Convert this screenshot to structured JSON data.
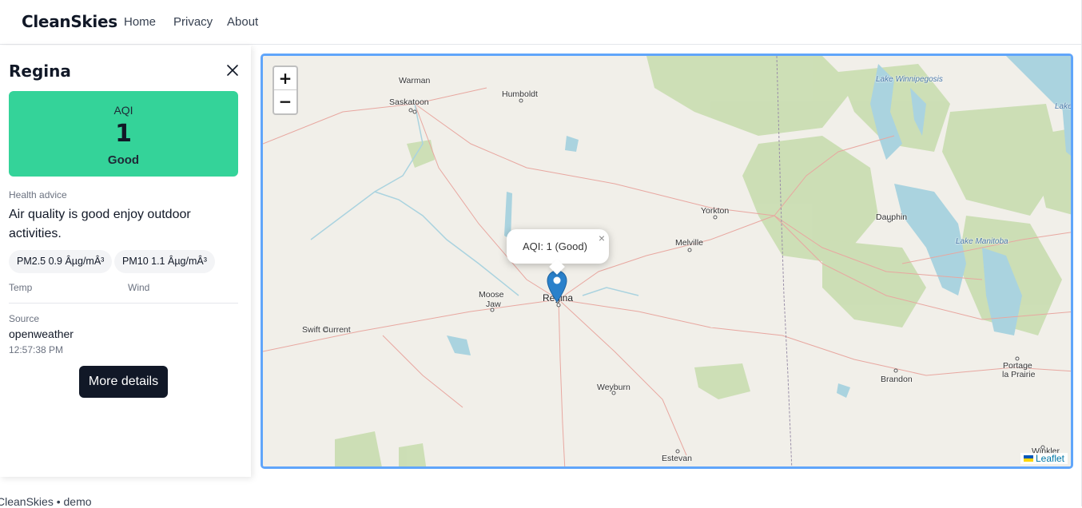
{
  "app": {
    "brand": "CleanSkies"
  },
  "nav": {
    "home": "Home",
    "privacy": "Privacy",
    "about": "About"
  },
  "panel": {
    "city": "Regina",
    "aqi_label": "AQI",
    "aqi_value": "1",
    "aqi_category": "Good",
    "aqi_color": "#34d399",
    "health_label": "Health advice",
    "health_advice": "Air quality is good enjoy outdoor activities.",
    "pollutants": [
      {
        "text": "PM2.5 0.9 Âµg/mÂ³"
      },
      {
        "text": "PM10 1.1 Âµg/mÂ³"
      }
    ],
    "temp_label": "Temp",
    "wind_label": "Wind",
    "source_label": "Source",
    "source_value": "openweather",
    "timestamp": "12:57:38 PM",
    "more_details": "More details"
  },
  "map": {
    "zoom_in": "+",
    "zoom_out": "−",
    "popup_text": "AQI: 1 (Good)",
    "popup_close": "×",
    "attribution": "Leaflet",
    "labels": {
      "warman": "Warman",
      "saskatoon": "Saskatoon",
      "humboldt": "Humboldt",
      "lake_winnipegosis": "Lake Winnipegosis",
      "lake_edge": "Lake",
      "yorkton": "Yorkton",
      "dauphin": "Dauphin",
      "melville": "Melville",
      "lake_manitoba": "Lake Manitoba",
      "moose": "Moose",
      "jaw": "Jaw",
      "regina": "Regina",
      "swift_current": "Swift Current",
      "brandon": "Brandon",
      "portage": "Portage",
      "la_prairie": "la Prairie",
      "weyburn": "Weyburn",
      "estevan": "Estevan",
      "winkler": "Winkler"
    }
  },
  "footer": {
    "text": "CleanSkies • demo"
  }
}
